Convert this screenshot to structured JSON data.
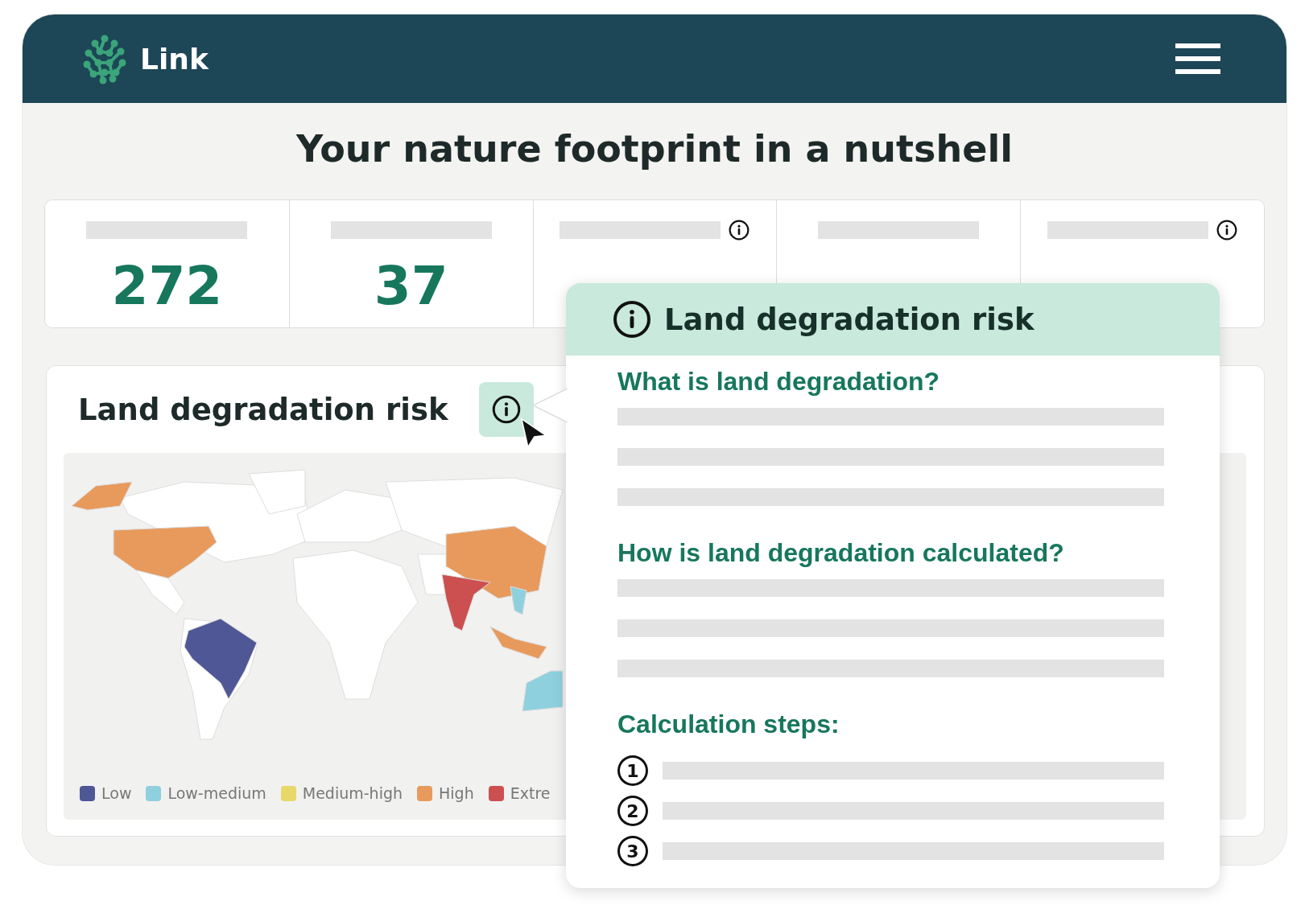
{
  "header": {
    "brand": "Link"
  },
  "title": "Your nature footprint in a nutshell",
  "stats": [
    {
      "value": "272",
      "info": false
    },
    {
      "value": "37",
      "info": false
    },
    {
      "info": true
    },
    {
      "info": false
    },
    {
      "info": true
    }
  ],
  "map_card": {
    "title": "Land degradation risk",
    "legend": [
      {
        "label": "Low",
        "color": "#4f5796"
      },
      {
        "label": "Low-medium",
        "color": "#8fd0de"
      },
      {
        "label": "Medium-high",
        "color": "#e8d86a"
      },
      {
        "label": "High",
        "color": "#e89a5c"
      },
      {
        "label": "Extre",
        "color": "#cc5050"
      }
    ]
  },
  "popover": {
    "title": "Land degradation risk",
    "sections": [
      {
        "heading": "What is land degradation?"
      },
      {
        "heading": "How is land degradation calculated?"
      }
    ],
    "steps_heading": "Calculation steps:",
    "steps": [
      "1",
      "2",
      "3"
    ]
  }
}
